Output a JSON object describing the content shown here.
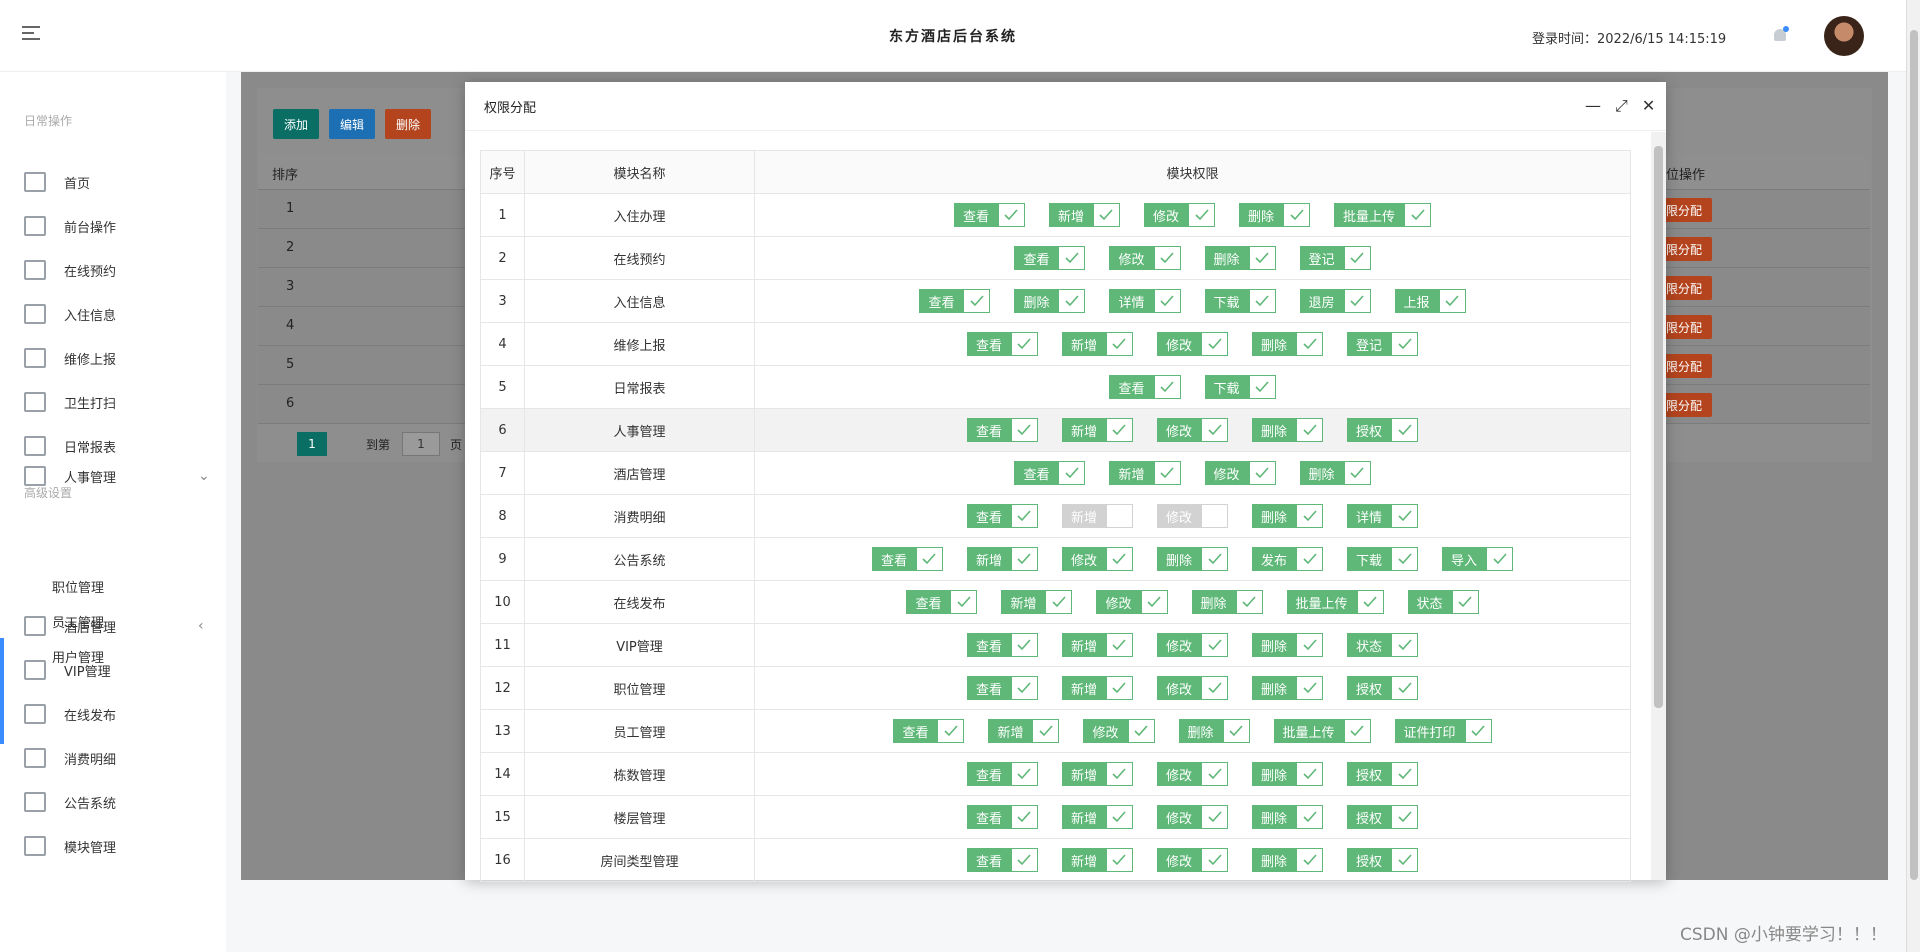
{
  "header": {
    "title": "东方酒店后台系统",
    "login_time": "登录时间：2022/6/15 14:15:19"
  },
  "sidebar": {
    "group1": "日常操作",
    "group2": "高级设置",
    "items1": [
      "首页",
      "前台操作",
      "在线预约",
      "入住信息",
      "维修上报",
      "卫生打扫",
      "日常报表"
    ],
    "items2": [
      {
        "label": "人事管理",
        "arrow": "⌄"
      },
      {
        "label": "酒店管理",
        "arrow": "‹"
      },
      {
        "label": "VIP管理"
      },
      {
        "label": "在线发布"
      },
      {
        "label": "消费明细"
      },
      {
        "label": "公告系统"
      },
      {
        "label": "模块管理"
      }
    ],
    "sub_items": [
      "职位管理",
      "员工管理",
      "用户管理"
    ]
  },
  "background": {
    "buttons": {
      "add": "添加",
      "edit": "编辑",
      "delete": "删除"
    },
    "col_sort": "排序",
    "col_action": "位操作",
    "rows": [
      "1",
      "2",
      "3",
      "4",
      "5",
      "6"
    ],
    "row_action": "限分配",
    "pager": {
      "current": "1",
      "goto": "到第",
      "page_input": "1",
      "page_suffix": "页"
    }
  },
  "modal": {
    "title": "权限分配",
    "columns": [
      "序号",
      "模块名称",
      "模块权限"
    ],
    "rows": [
      {
        "no": "1",
        "name": "入住办理",
        "perms": [
          {
            "label": "查看"
          },
          {
            "label": "新增"
          },
          {
            "label": "修改"
          },
          {
            "label": "删除"
          },
          {
            "label": "批量上传"
          }
        ]
      },
      {
        "no": "2",
        "name": "在线预约",
        "perms": [
          {
            "label": "查看"
          },
          {
            "label": "修改"
          },
          {
            "label": "删除"
          },
          {
            "label": "登记"
          }
        ]
      },
      {
        "no": "3",
        "name": "入住信息",
        "perms": [
          {
            "label": "查看"
          },
          {
            "label": "删除"
          },
          {
            "label": "详情"
          },
          {
            "label": "下载"
          },
          {
            "label": "退房"
          },
          {
            "label": "上报"
          }
        ]
      },
      {
        "no": "4",
        "name": "维修上报",
        "perms": [
          {
            "label": "查看"
          },
          {
            "label": "新增"
          },
          {
            "label": "修改"
          },
          {
            "label": "删除"
          },
          {
            "label": "登记"
          }
        ]
      },
      {
        "no": "5",
        "name": "日常报表",
        "perms": [
          {
            "label": "查看"
          },
          {
            "label": "下载"
          }
        ]
      },
      {
        "no": "6",
        "name": "人事管理",
        "perms": [
          {
            "label": "查看"
          },
          {
            "label": "新增"
          },
          {
            "label": "修改"
          },
          {
            "label": "删除"
          },
          {
            "label": "授权"
          }
        ]
      },
      {
        "no": "7",
        "name": "酒店管理",
        "perms": [
          {
            "label": "查看"
          },
          {
            "label": "新增"
          },
          {
            "label": "修改"
          },
          {
            "label": "删除"
          }
        ]
      },
      {
        "no": "8",
        "name": "消费明细",
        "perms": [
          {
            "label": "查看"
          },
          {
            "label": "新增",
            "off": true
          },
          {
            "label": "修改",
            "off": true
          },
          {
            "label": "删除"
          },
          {
            "label": "详情"
          }
        ]
      },
      {
        "no": "9",
        "name": "公告系统",
        "perms": [
          {
            "label": "查看"
          },
          {
            "label": "新增"
          },
          {
            "label": "修改"
          },
          {
            "label": "删除"
          },
          {
            "label": "发布"
          },
          {
            "label": "下载"
          },
          {
            "label": "导入"
          }
        ]
      },
      {
        "no": "10",
        "name": "在线发布",
        "perms": [
          {
            "label": "查看"
          },
          {
            "label": "新增"
          },
          {
            "label": "修改"
          },
          {
            "label": "删除"
          },
          {
            "label": "批量上传"
          },
          {
            "label": "状态"
          }
        ]
      },
      {
        "no": "11",
        "name": "VIP管理",
        "perms": [
          {
            "label": "查看"
          },
          {
            "label": "新增"
          },
          {
            "label": "修改"
          },
          {
            "label": "删除"
          },
          {
            "label": "状态"
          }
        ]
      },
      {
        "no": "12",
        "name": "职位管理",
        "perms": [
          {
            "label": "查看"
          },
          {
            "label": "新增"
          },
          {
            "label": "修改"
          },
          {
            "label": "删除"
          },
          {
            "label": "授权"
          }
        ]
      },
      {
        "no": "13",
        "name": "员工管理",
        "perms": [
          {
            "label": "查看"
          },
          {
            "label": "新增"
          },
          {
            "label": "修改"
          },
          {
            "label": "删除"
          },
          {
            "label": "批量上传"
          },
          {
            "label": "证件打印"
          }
        ]
      },
      {
        "no": "14",
        "name": "栋数管理",
        "perms": [
          {
            "label": "查看"
          },
          {
            "label": "新增"
          },
          {
            "label": "修改"
          },
          {
            "label": "删除"
          },
          {
            "label": "授权"
          }
        ]
      },
      {
        "no": "15",
        "name": "楼层管理",
        "perms": [
          {
            "label": "查看"
          },
          {
            "label": "新增"
          },
          {
            "label": "修改"
          },
          {
            "label": "删除"
          },
          {
            "label": "授权"
          }
        ]
      },
      {
        "no": "16",
        "name": "房间类型管理",
        "perms": [
          {
            "label": "查看"
          },
          {
            "label": "新增"
          },
          {
            "label": "修改"
          },
          {
            "label": "删除"
          },
          {
            "label": "授权"
          }
        ]
      }
    ]
  },
  "watermark": "CSDN @小钟要学习！！！"
}
